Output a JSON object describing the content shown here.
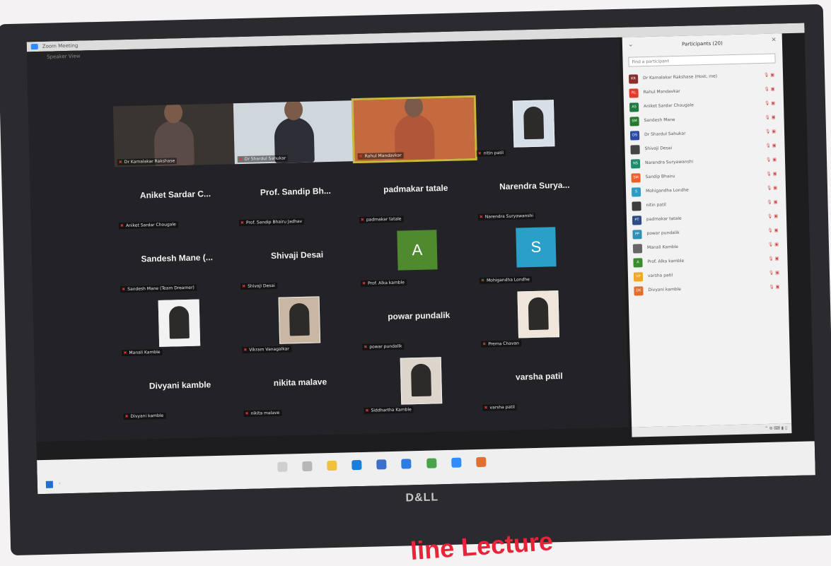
{
  "window": {
    "title": "Zoom Meeting",
    "view_label": "Speaker View"
  },
  "panel": {
    "title": "Participants (20)",
    "search_placeholder": "Find a participant",
    "items": [
      {
        "initials": "KR",
        "name": "Dr Kamalakar Rakshase (Host, me)",
        "color": "#8a2d2d"
      },
      {
        "initials": "RL",
        "name": "Rahul Mandavkar",
        "color": "#e03c2c"
      },
      {
        "initials": "AS",
        "name": "Aniket Sardar Chougale",
        "color": "#1e7a3e"
      },
      {
        "initials": "SM",
        "name": "Sandesh Mane",
        "color": "#237a2f"
      },
      {
        "initials": "DS",
        "name": "Dr Shardul Sahukar",
        "color": "#2b4aa8"
      },
      {
        "initials": "",
        "name": "Shivaji Desai",
        "color": "#444444"
      },
      {
        "initials": "NS",
        "name": "Narendra Suryawanshi",
        "color": "#1f8a6c"
      },
      {
        "initials": "SM",
        "name": "Sandip Bhairu",
        "color": "#e8612b"
      },
      {
        "initials": "S",
        "name": "Mohigandha Londhe",
        "color": "#2b9cc2"
      },
      {
        "initials": "",
        "name": "nitin patil",
        "color": "#3c3c3c"
      },
      {
        "initials": "PT",
        "name": "padmakar tatale",
        "color": "#2d4b86"
      },
      {
        "initials": "PP",
        "name": "powar pundalik",
        "color": "#2f8fb4"
      },
      {
        "initials": "",
        "name": "Manali Kamble",
        "color": "#666666"
      },
      {
        "initials": "A",
        "name": "Prof. Alka kamble",
        "color": "#3a8a2e"
      },
      {
        "initials": "VP",
        "name": "varsha patil",
        "color": "#f0a628"
      },
      {
        "initials": "DK",
        "name": "Divyani kamble",
        "color": "#e0702f"
      }
    ]
  },
  "tiles": [
    {
      "label": "Dr Kamalakar Rakshase",
      "kind": "video",
      "color": "#3a3530"
    },
    {
      "label": "Dr Shardul Sahukar",
      "kind": "video",
      "color": "#cfd6dc"
    },
    {
      "label": "Rahul Mandavkar",
      "kind": "video-active",
      "color": "#c56a3f"
    },
    {
      "label": "nitin patil",
      "kind": "photo",
      "color": "#d6dfe8"
    },
    {
      "big": "Aniket Sardar C...",
      "label": "Aniket Sardar Chougale"
    },
    {
      "big": "Prof. Sandip Bh...",
      "label": "Prof. Sandip Bhairu Jadhav"
    },
    {
      "big": "padmakar tatale",
      "label": "padmakar tatale"
    },
    {
      "big": "Narendra Surya...",
      "label": "Narendra Suryawanshi"
    },
    {
      "big": "Sandesh Mane (...",
      "label": "Sandesh Mane (Team Dreamer)"
    },
    {
      "big": "Shivaji Desai",
      "label": "Shivaji Desai"
    },
    {
      "avatar": "A",
      "label": "Prof. Alka kamble",
      "color": "#4f8a2e"
    },
    {
      "avatar": "S",
      "label": "Mohigandha Londhe",
      "color": "#2aa0c8"
    },
    {
      "label": "Manali Kamble",
      "kind": "photo",
      "color": "#f2f2f2"
    },
    {
      "label": "Vikram Vanagalkar",
      "kind": "photo",
      "color": "#c9b7a4"
    },
    {
      "big": "powar pundalik",
      "label": "powar pundalik"
    },
    {
      "label": "Prema Chavan",
      "kind": "photo",
      "color": "#efe6d9"
    },
    {
      "big": "Divyani kamble",
      "label": "Divyani kamble"
    },
    {
      "big": "nikita malave",
      "label": "nikita malave"
    },
    {
      "label": "Siddhartha Kamble",
      "kind": "photo",
      "color": "#ddd5cc"
    },
    {
      "big": "varsha patil",
      "label": "varsha patil"
    }
  ],
  "brand": "D&LL",
  "caption": "line Lecture",
  "accent": "#c8b93a"
}
